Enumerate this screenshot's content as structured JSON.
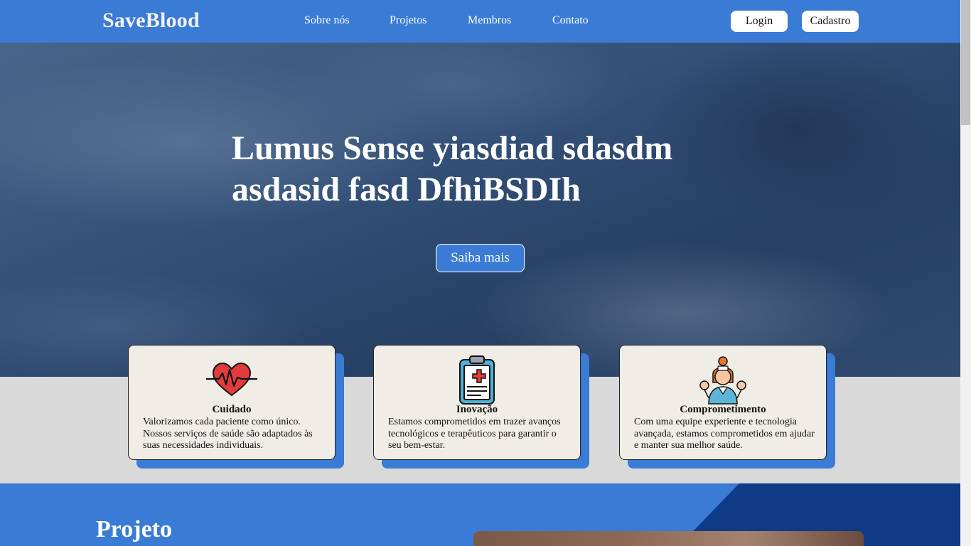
{
  "header": {
    "brand": "SaveBlood",
    "nav": [
      "Sobre nós",
      "Projetos",
      "Membros",
      "Contato"
    ],
    "login_label": "Login",
    "signup_label": "Cadastro"
  },
  "hero": {
    "title": "Lumus Sense yiasdiad sdasdm asdasid fasd DfhiBSDIh",
    "cta_label": "Saiba mais"
  },
  "cards": [
    {
      "icon": "heartbeat-icon",
      "title": "Cuidado",
      "text": "Valorizamos cada paciente como único. Nossos serviços de saúde são adaptados às suas necessidades individuais."
    },
    {
      "icon": "medical-clipboard-icon",
      "title": "Inovação",
      "text": "Estamos comprometidos em trazer avanços tecnológicos e terapêuticos para garantir o seu bem-estar."
    },
    {
      "icon": "nurse-icon",
      "title": "Comprometimento",
      "text": "Com uma equipe experiente e tecnologia avançada, estamos comprometidos em ajudar e manter sua melhor saúde."
    }
  ],
  "projeto": {
    "title": "Projeto"
  },
  "colors": {
    "primary": "#3a7bd5",
    "dark_blue": "#0f3a85",
    "card_bg": "#f0ede6",
    "section_bg": "#d9d9d9"
  }
}
